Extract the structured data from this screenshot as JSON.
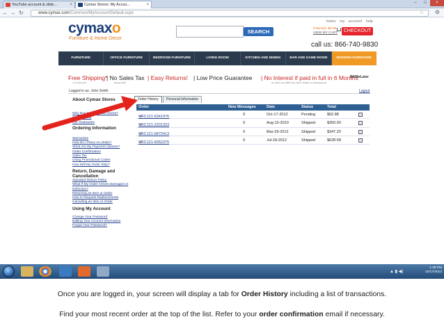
{
  "browser": {
    "tabs": [
      {
        "label": "YouTube account & slide..."
      },
      {
        "label": "Cymax Stores: My Accou..."
      }
    ],
    "url_host": "www.cymax.com",
    "url_path": "/Common/MyAccount/Default.aspx"
  },
  "header": {
    "logo": "cymax",
    "logo_o": "o",
    "tagline": "Furniture & Home Decor",
    "top_links": "home   my account   help",
    "search_label": "SEARCH",
    "cart_items": "0 item(s): $0.00",
    "cart_link": "VIEW MY CART",
    "checkout_label": "CHECKOUT",
    "phone": "call us: 866-740-9830"
  },
  "menu": [
    "FURNITURE",
    "OFFICE FURNITURE",
    "BEDROOM FURNITURE",
    "LIVING ROOM",
    "KITCHEN AND DINING",
    "BAR AND GAME ROOM",
    "MODERN FURNITURE"
  ],
  "promo": {
    "shipping": "Free Shipping*",
    "shipping_note": "*on most items",
    "sales_tax": "| No Sales Tax",
    "sales_tax_note": "(Except WA)",
    "returns": "| Easy Returns!",
    "guarantee": "| Low Price Guarantee",
    "interest": "| No Interest if paid in full in 6 Months",
    "interest_note": "On orders over $250. See Terms. Subject to credit approval",
    "billme": "BillMeLater"
  },
  "account": {
    "logged_in": "Logged in as: John Smith",
    "logout": "Logout"
  },
  "sidebar": {
    "about_heading": "About Cymax Stores",
    "about_links": [
      "Why Buy From Cymax Stores?",
      "Social Media",
      "Our Guarantee"
    ],
    "ordering_heading": "Ordering Information",
    "ordering_links": [
      "Warranties",
      "How Do I Place An Order?",
      "What Are My Payment Options?",
      "Order Confirmation",
      "Sales Tax",
      "Using Promotional Codes",
      "How Will My Order Ship?"
    ],
    "returns_heading": "Return, Damage and Cancellation",
    "returns_links": [
      "Standard Return Policy",
      "What If My Order Arrives Damaged or Defective?",
      "Returning an Item or Order",
      "How to Request Replacements",
      "Canceling an Item or Order"
    ],
    "myaccount_heading": "Using My Account",
    "myaccount_links": [
      "Change Your Password",
      "Editing Your Account Information",
      "Forgot Your Password?"
    ]
  },
  "tabs": {
    "order_history": "Order History",
    "personal_info": "Personal Information"
  },
  "grid": {
    "columns": [
      "Order",
      "New Messages",
      "Date",
      "Status",
      "Total"
    ],
    "rows": [
      {
        "order": "VRC121-6341976",
        "messages": "0",
        "date": "Oct-17-2012",
        "status": "Pending",
        "total": "$92.88"
      },
      {
        "order": "VRC121-2201323",
        "messages": "0",
        "date": "Aug-10-2010",
        "status": "Shipped",
        "total": "$350.00"
      },
      {
        "order": "VRC121-5872413",
        "messages": "0",
        "date": "Mar-29-2012",
        "status": "Shipped",
        "total": "$347.20"
      },
      {
        "order": "VRC121-6052375",
        "messages": "0",
        "date": "Jul-18-2012",
        "status": "Shipped",
        "total": "$628.58"
      }
    ]
  },
  "taskbar": {
    "time": "1:38 PM",
    "date": "10/17/2012"
  },
  "caption": {
    "line1_pre": "Once you are logged in, your screen will display a tab for ",
    "line1_bold": "Order History",
    "line1_post": " including a list of transactions.",
    "line2_pre": "Find your most recent order at the top of the list. Refer to your ",
    "line2_bold": "order confirmation",
    "line2_post": " email if necessary."
  },
  "colors": {
    "menu_bg": "#2b3a4c",
    "menu_active": "#f09a25",
    "grid_header": "#2e5f92",
    "arrow": "#e3231c"
  }
}
